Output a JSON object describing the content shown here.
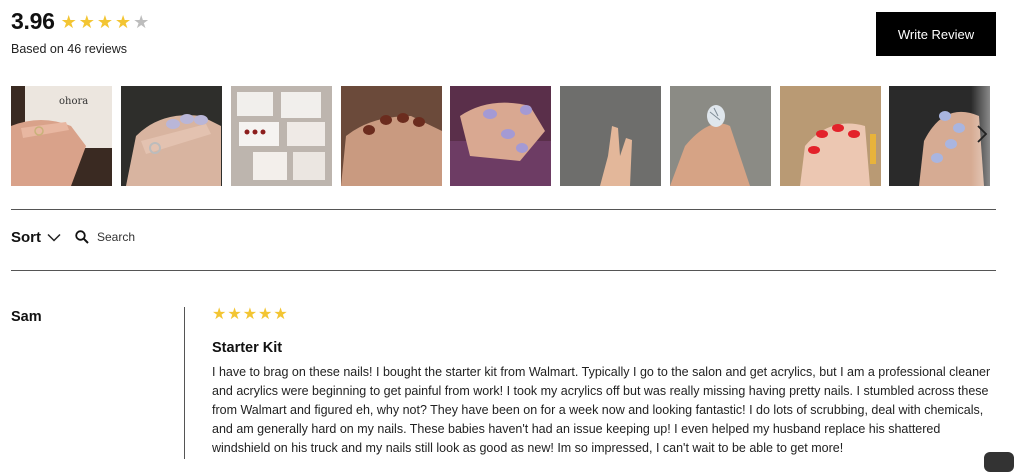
{
  "summary": {
    "average": "3.96",
    "stars_filled": 4,
    "stars_total": 5,
    "based_on": "Based on 46 reviews"
  },
  "actions": {
    "write_review": "Write Review"
  },
  "gallery": {
    "thumbnails": [
      {
        "name": "photo-hand-ohora-box",
        "logo_text": "ohora"
      },
      {
        "name": "photo-lilac-nails-ring"
      },
      {
        "name": "photo-nail-kit-boxes"
      },
      {
        "name": "photo-brown-nails-hand"
      },
      {
        "name": "photo-lilac-nails-sweater"
      },
      {
        "name": "photo-bare-fingers-couch"
      },
      {
        "name": "photo-marble-thumb-nail"
      },
      {
        "name": "photo-red-nails-floor"
      },
      {
        "name": "photo-blue-nails-hand"
      }
    ]
  },
  "controls": {
    "sort_label": "Sort",
    "search_label": "Search"
  },
  "review": {
    "author": "Sam",
    "stars": 5,
    "title": "Starter Kit",
    "body": "I have to brag on these nails! I bought the starter kit from Walmart. Typically I go to the salon and get acrylics, but I am a professional cleaner and acrylics were beginning to get painful from work! I took my acrylics off but was really missing having pretty nails. I stumbled across these from Walmart and figured eh, why not? They have been on for a week now and looking fantastic! I do lots of scrubbing, deal with chemicals, and am generally hard on my nails. These babies haven't had an issue keeping up! I even helped my husband replace his shattered windshield on his truck and my nails still look as good as new! Im so impressed, I can't wait to be able to get more!"
  },
  "colors": {
    "star": "#f3c533",
    "star_empty": "#bdbdbd",
    "button_bg": "#000000"
  }
}
